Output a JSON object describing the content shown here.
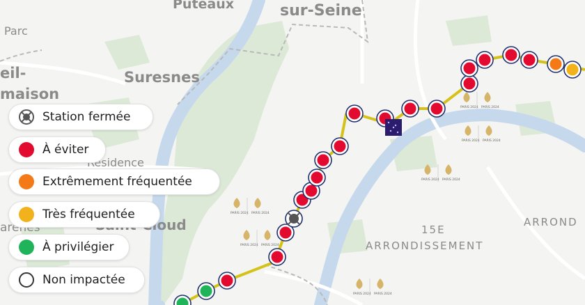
{
  "map": {
    "place_labels": {
      "puteaux": "Puteaux",
      "sur_seine": "sur-Seine",
      "parc": "Parc",
      "suresnes": "Suresnes",
      "eil": "eil-",
      "maison": "maison",
      "residence": "Résidence",
      "arenes": "arènes",
      "saint_cloud": "Saint-Cloud",
      "fifteenth": "15E",
      "arrondissement": "ARRONDISSEMENT",
      "arrond": "ARROND"
    },
    "olympic_badge": {
      "left": "PARIS 2024",
      "right": "PARIS 2024"
    },
    "colors": {
      "water": "#c6d9ec",
      "park": "#dde9d7",
      "route": "#d4c21a",
      "avoid": "#e20a2f",
      "extreme": "#f47a18",
      "very_busy": "#f2b21b",
      "preferred": "#1fb45a",
      "closed": "#555555",
      "boundary": "#b8b8b8"
    }
  },
  "legend": {
    "items": [
      {
        "key": "closed",
        "label": "Station fermée",
        "icon": "closed-station-icon"
      },
      {
        "key": "avoid",
        "label": "À éviter",
        "icon": "red-dot-icon",
        "color": "#e20a2f"
      },
      {
        "key": "extreme",
        "label": "Extrêmement fréquentée",
        "icon": "orange-dot-icon",
        "color": "#f47a18"
      },
      {
        "key": "very_busy",
        "label": "Très fréquentée",
        "icon": "yellow-dot-icon",
        "color": "#f2b21b"
      },
      {
        "key": "preferred",
        "label": "À privilégier",
        "icon": "green-dot-icon",
        "color": "#1fb45a"
      },
      {
        "key": "unaffected",
        "label": "Non impactée",
        "icon": "empty-dot-icon",
        "color": "#ffffff"
      }
    ]
  }
}
